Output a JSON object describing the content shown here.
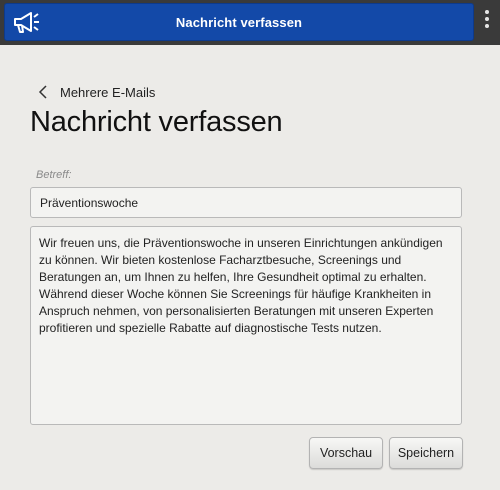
{
  "window": {
    "title": "Nachricht verfassen",
    "app_icon": "megaphone-icon",
    "menu_icon": "more-vertical-icon"
  },
  "nav": {
    "back_icon": "chevron-left-icon",
    "back_label": "Mehrere E-Mails"
  },
  "page": {
    "title": "Nachricht verfassen"
  },
  "form": {
    "subject_label": "Betreff:",
    "subject_value": "Präventionswoche",
    "body_value": "Wir freuen uns, die Präventionswoche in unseren Einrichtungen ankündigen zu können. Wir bieten kostenlose Facharztbesuche, Screenings und Beratungen an, um Ihnen zu helfen, Ihre Gesundheit optimal zu erhalten. Während dieser Woche können Sie Screenings für häufige Krankheiten in Anspruch nehmen, von personalisierten Beratungen mit unseren Experten profitieren und spezielle Rabatte auf diagnostische Tests nutzen."
  },
  "actions": {
    "preview_label": "Vorschau",
    "save_label": "Speichern"
  },
  "colors": {
    "title_bar": "#1349a8",
    "window_frame": "#3a3a3a",
    "background": "#ecebe8"
  }
}
